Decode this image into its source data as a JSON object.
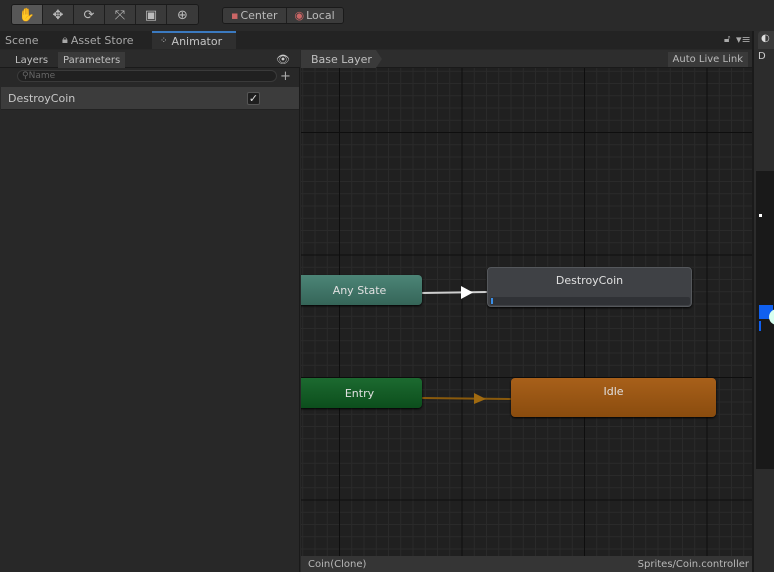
{
  "toolbar": {
    "tools": [
      "hand-icon",
      "move-icon",
      "rotate-icon",
      "scale-icon",
      "rect-icon",
      "transform-icon"
    ],
    "pivot": "Center",
    "space": "Local"
  },
  "tabs": [
    {
      "label": "Scene"
    },
    {
      "label": "Asset Store"
    },
    {
      "label": "Animator"
    }
  ],
  "left": {
    "tabs": [
      "Layers",
      "Parameters"
    ],
    "search_placeholder": "Name",
    "parameters": [
      {
        "name": "DestroyCoin",
        "type": "trigger",
        "checked": true
      }
    ]
  },
  "graph": {
    "breadcrumb": "Base Layer",
    "auto_live_link": "Auto Live Link",
    "nodes": {
      "any_state": "Any State",
      "destroy": "DestroyCoin",
      "entry": "Entry",
      "idle": "Idle"
    },
    "colors": {
      "any_state": "#3f776a",
      "entry": "#125a24",
      "idle": "#a25c14",
      "state": "#424448",
      "transition": "#cccccc",
      "entry_transition": "#a06a10"
    }
  },
  "status": {
    "left": "Coin(Clone)",
    "right": "Sprites/Coin.controller"
  },
  "right_panel": {
    "tab": "D"
  }
}
